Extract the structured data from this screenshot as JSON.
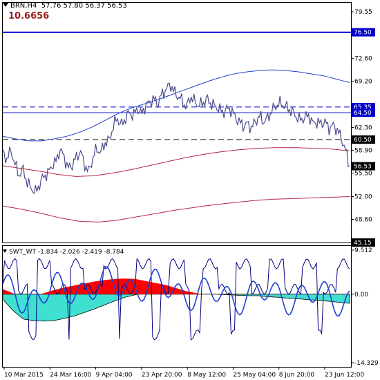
{
  "header": {
    "symbol_label": "BRN,H4",
    "ohlc": "57.76 57.80 56.37 56.53",
    "big_value": "10.6656"
  },
  "indicator": {
    "header": "SWT_WT -1.834 -2.026 -2.419 -8.784",
    "top_value": "9.512",
    "zero_label": "0.00",
    "bottom_value": "-14.329"
  },
  "axis": {
    "price_ticks": [
      "79.55",
      "72.60",
      "69.20",
      "62.30",
      "58.90",
      "55.50",
      "52.00",
      "48.60"
    ],
    "time_ticks": [
      "10 Mar 2015",
      "24 Mar 16:00",
      "9 Apr 04:00",
      "23 Apr 20:00",
      "8 May 12:00",
      "25 May 04:00",
      "8 Jun 20:00",
      "23 Jun 12:00"
    ]
  },
  "price_tags": [
    {
      "text": "76.50",
      "style": "blue"
    },
    {
      "text": "65.35",
      "style": "blue"
    },
    {
      "text": "64.50",
      "style": "blue"
    },
    {
      "text": "60.50",
      "style": "black"
    },
    {
      "text": "56.53",
      "style": "black"
    },
    {
      "text": "45.15",
      "style": "black"
    }
  ],
  "colors": {
    "price_line": "#4a4a8c",
    "level_blue": "#0000cc",
    "upper_band": "#1f3fd0",
    "lower_band": "#b0224a",
    "hist_positive": "#ff0000",
    "hist_negative": "#40e0d0",
    "osc_fast": "#1f3fd0",
    "osc_slow": "#000080"
  },
  "chart_data": [
    {
      "type": "line",
      "title": "",
      "y_range": [
        45.15,
        80.9
      ],
      "series": [
        {
          "values": [
            58.5,
            57.6,
            58.9,
            56.8,
            55.2,
            56.1,
            54.0,
            53.3,
            52.6,
            53.8,
            55.0,
            55.4,
            56.6,
            57.2,
            59.0,
            58.0,
            56.2,
            56.7,
            57.8,
            58.8,
            56.9,
            55.6,
            57.6,
            59.2,
            58.5,
            60.0,
            60.3,
            62.3,
            63.8,
            62.6,
            63.6,
            64.6,
            64.0,
            65.2,
            64.2,
            65.6,
            66.1,
            66.6,
            65.8,
            67.3,
            67.9,
            68.8,
            67.6,
            66.9,
            66.3,
            65.2,
            67.0,
            66.2,
            65.6,
            65.9,
            66.6,
            65.9,
            65.5,
            65.1,
            64.5,
            65.1,
            64.9,
            63.8,
            63.1,
            62.5,
            62.9,
            62.2,
            63.3,
            64.0,
            63.1,
            63.8,
            64.9,
            65.6,
            65.9,
            65.6,
            65.1,
            64.6,
            63.9,
            63.4,
            63.8,
            64.1,
            62.9,
            63.1,
            62.9,
            63.1,
            62.2,
            62.6,
            61.9,
            60.7,
            58.9,
            56.53
          ],
          "start_label": "10 Mar 2015",
          "end_label": "23 Jun 12:00"
        },
        {
          "values": [
            61.0,
            60.6,
            60.3,
            60.3,
            60.6,
            61.0,
            61.6,
            62.4,
            63.4,
            64.4,
            65.2,
            65.8,
            66.4,
            67.1,
            67.8,
            68.5,
            69.2,
            69.8,
            70.3,
            70.6,
            70.8,
            70.9,
            70.8,
            70.6,
            70.3,
            70.0,
            69.5,
            69.0
          ]
        },
        {
          "values": [
            56.6,
            56.2,
            55.8,
            55.3,
            55.0,
            55.1,
            55.5,
            56.0,
            56.6,
            57.2,
            57.8,
            58.3,
            58.7,
            59.0,
            59.2,
            59.3,
            59.3,
            59.2,
            59.1,
            58.8
          ]
        },
        {
          "values": [
            50.6,
            50.1,
            49.5,
            48.8,
            48.3,
            48.2,
            48.5,
            49.0,
            49.5,
            50.0,
            50.4,
            50.8,
            51.1,
            51.4,
            51.6,
            51.7,
            51.8,
            51.9,
            52.0
          ]
        }
      ],
      "levels": [
        76.5,
        65.35,
        64.5,
        60.5
      ]
    },
    {
      "type": "area",
      "title": "",
      "y_range": [
        -14.329,
        9.512
      ],
      "series": [
        {
          "values": [
            1.0,
            0.2,
            -0.9,
            -0.6,
            0.2,
            0.8,
            1.3,
            1.7,
            2.1,
            2.5,
            2.8,
            3.0,
            3.1,
            3.0,
            2.6,
            2.2,
            1.8,
            1.2,
            0.6,
            0.2,
            -0.2,
            -0.4,
            -0.6,
            -0.6,
            -0.4,
            -0.2,
            -0.2,
            -0.4,
            -0.5,
            -0.6,
            -0.8,
            -1.0,
            -0.8,
            -1.2,
            -1.6
          ]
        },
        {
          "values": [
            -1.0,
            -3.2,
            -4.9,
            -5.2,
            -5.3,
            -5.2,
            -4.8,
            -4.3,
            -3.6,
            -2.9,
            -2.1,
            -1.3,
            -0.6,
            -0.1,
            0.2,
            0.4,
            0.5,
            0.4,
            0.3,
            0.2,
            0.1,
            0.0,
            -0.1,
            -0.2,
            -0.3,
            -0.3,
            -0.5,
            -0.6,
            -0.8,
            -0.9,
            -1.1,
            -1.2,
            -1.4,
            -1.6,
            -1.8
          ]
        }
      ]
    }
  ]
}
